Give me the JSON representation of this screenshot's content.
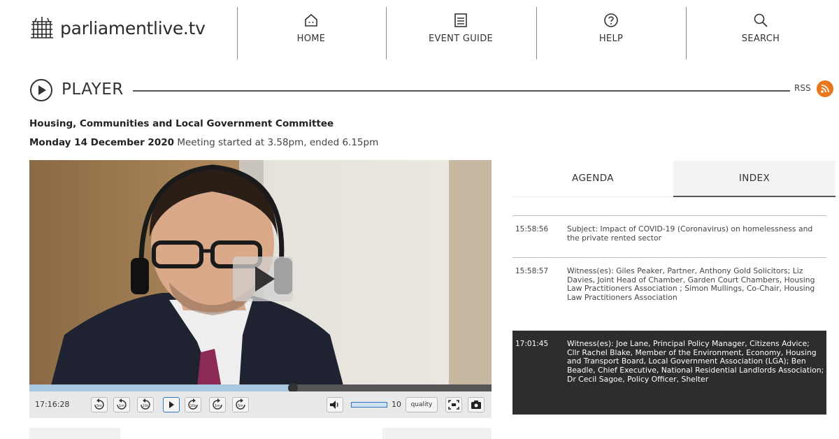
{
  "site": {
    "name": "parliamentlive.tv"
  },
  "nav": [
    {
      "id": "home",
      "label": "HOME",
      "icon": "home-icon"
    },
    {
      "id": "event-guide",
      "label": "EVENT GUIDE",
      "icon": "list-icon"
    },
    {
      "id": "help",
      "label": "HELP",
      "icon": "question-icon"
    },
    {
      "id": "search",
      "label": "SEARCH",
      "icon": "search-icon"
    }
  ],
  "player": {
    "title": "PLAYER",
    "rss_label": "RSS",
    "committee": "Housing, Communities and Local Government Committee",
    "date": "Monday 14 December 2020",
    "meeting_info": "Meeting started at 3.58pm, ended 6.15pm"
  },
  "controls": {
    "current_time": "17:16:28",
    "progress": 0.57,
    "skip_back": [
      "5m",
      "1m",
      "10s"
    ],
    "skip_forward": [
      "10s",
      "1m",
      "5m"
    ],
    "volume": "10",
    "volume_level": 1.0,
    "quality_label": "quality"
  },
  "tabs": [
    {
      "label": "AGENDA",
      "active": false
    },
    {
      "label": "INDEX",
      "active": true
    }
  ],
  "index": [
    {
      "time": "15:58:56",
      "text": "Subject: Impact of COVID-19 (Coronavirus) on homelessness and the private rented sector",
      "active": false
    },
    {
      "time": "15:58:57",
      "text": "Witness(es): Giles Peaker, Partner, Anthony Gold Solicitors; Liz Davies, Joint Head of Chamber, Garden Court Chambers, Housing Law Practitioners Association ; Simon Mullings, Co-Chair, Housing Law Practitioners Association",
      "active": false
    },
    {
      "time": "17:01:45",
      "text": "Witness(es): Joe Lane, Principal Policy Manager, Citizens Advice; Cllr Rachel Blake, Member of the Environment, Economy, Housing and Transport Board, Local Government Association (LGA); Ben Beadle, Chief Executive, National Residential Landlords Association; Dr Cecil Sagoe, Policy Officer, Shelter",
      "active": true
    }
  ],
  "colors": {
    "accent": "#e8771e",
    "active_row": "#2d2d2d",
    "progress_fill": "#a9c7de"
  }
}
